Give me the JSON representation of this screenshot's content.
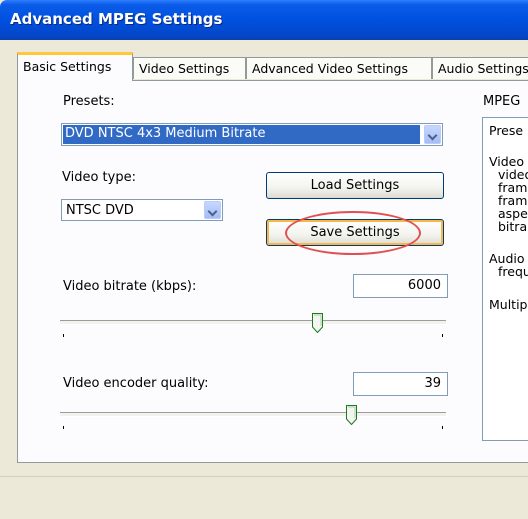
{
  "window": {
    "title": "Advanced MPEG Settings"
  },
  "tabs": [
    {
      "label": "Basic Settings"
    },
    {
      "label": "Video Settings"
    },
    {
      "label": "Advanced Video Settings"
    },
    {
      "label": "Audio Settings"
    }
  ],
  "basic": {
    "presets_label": "Presets:",
    "preset_value": "DVD NTSC 4x3 Medium Bitrate",
    "video_type_label": "Video type:",
    "video_type_value": "NTSC DVD",
    "load_button": "Load Settings",
    "save_button": "Save Settings",
    "bitrate_label": "Video bitrate (kbps):",
    "bitrate_value": "6000",
    "bitrate_slider_fraction": 0.67,
    "quality_label": "Video encoder quality:",
    "quality_value": "39",
    "quality_slider_fraction": 0.76
  },
  "preview": {
    "label": "MPEG",
    "lines": [
      "Prese",
      "Video",
      "video",
      "fram",
      "fram",
      "aspe",
      "bitra",
      "Audio",
      "frequ",
      "Multip"
    ]
  }
}
